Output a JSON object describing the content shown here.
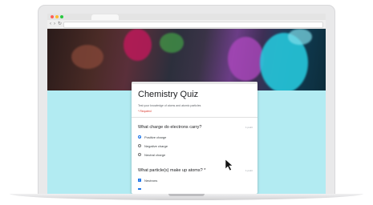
{
  "quiz": {
    "title": "Chemistry Quiz",
    "description": "Test your knowledge of atoms and atomic particles",
    "required_note": "* Required",
    "questions": [
      {
        "text": "What charge do electrons carry?",
        "hint": "1 point",
        "type": "radio",
        "options": [
          {
            "label": "Positive charge",
            "selected": true
          },
          {
            "label": "Negative charge",
            "selected": false
          },
          {
            "label": "Neutral charge",
            "selected": false
          }
        ]
      },
      {
        "text": "What particle(s) make up atoms? *",
        "hint": "1 point",
        "type": "checkbox",
        "options": [
          {
            "label": "Neutrons",
            "selected": true
          }
        ]
      }
    ]
  },
  "colors": {
    "accent": "#1a73e8",
    "background": "#b2ebf2",
    "required": "#d93025"
  },
  "icons": {
    "cursor": "arrow-cursor-icon"
  }
}
